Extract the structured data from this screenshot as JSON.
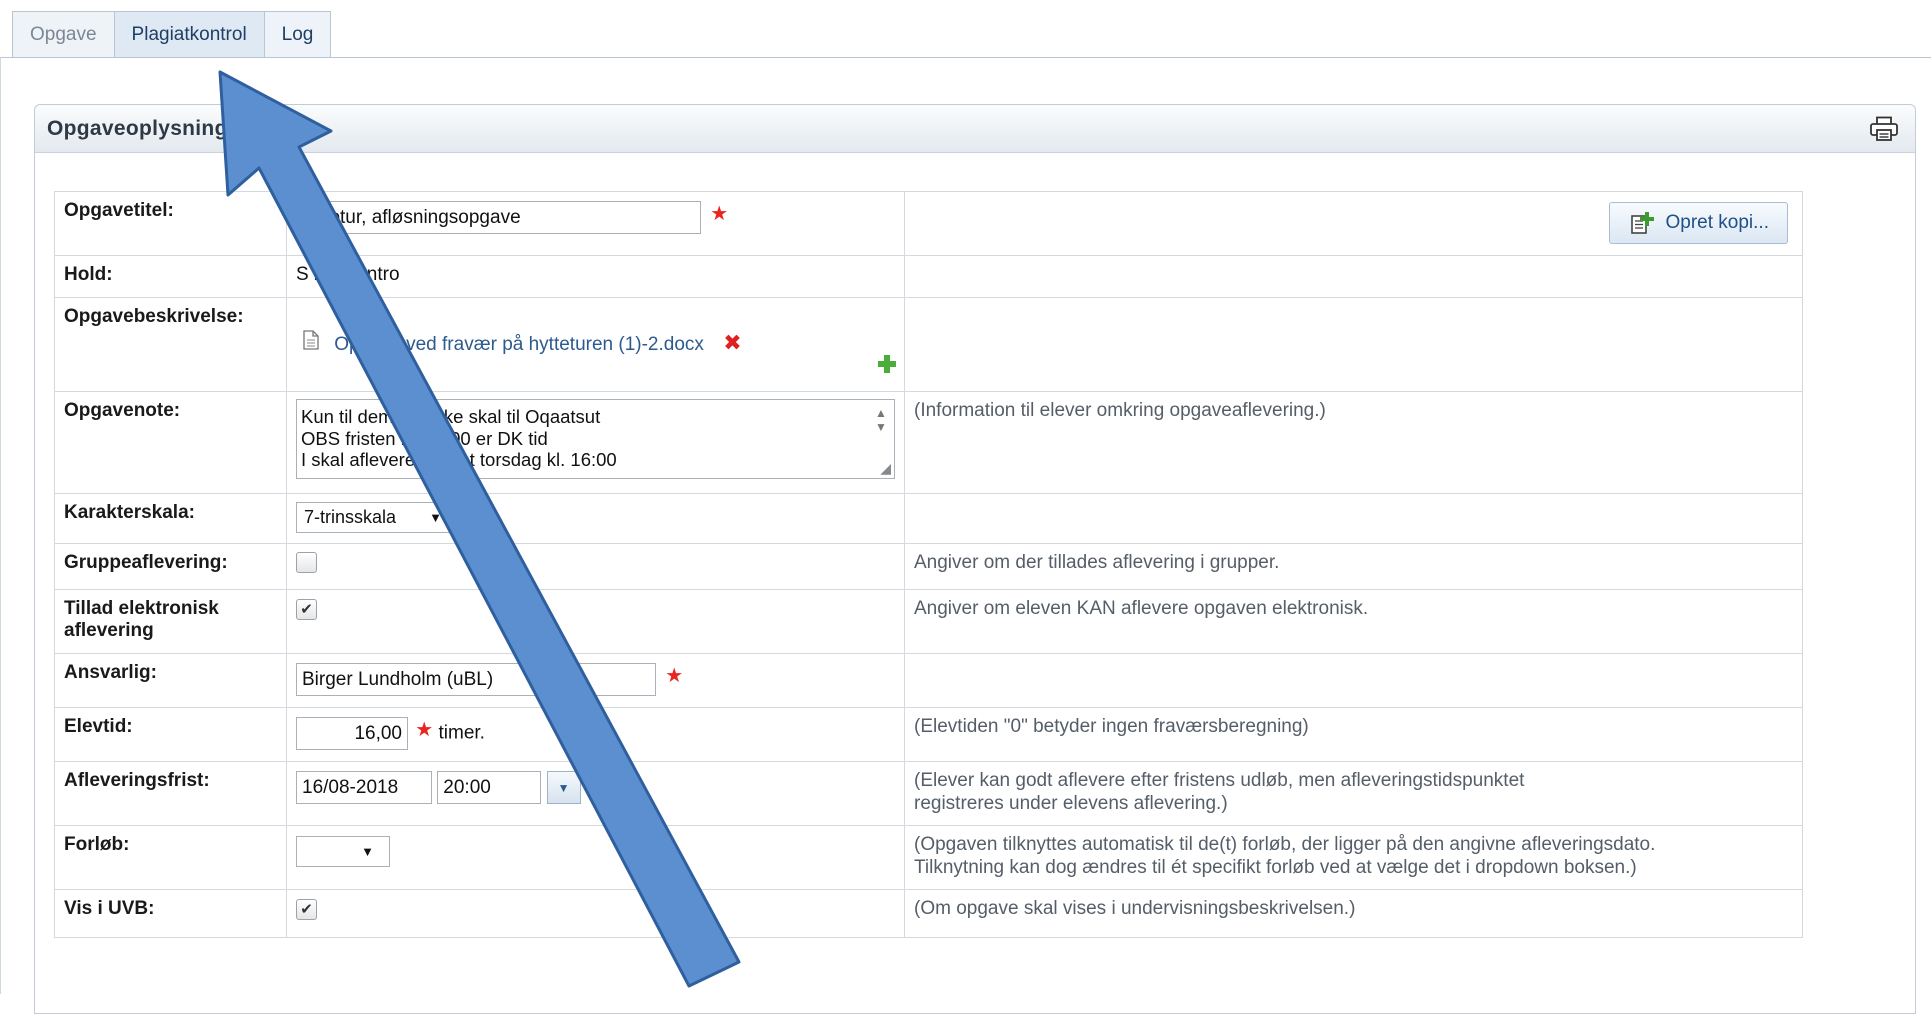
{
  "tabs": [
    {
      "label": "Opgave"
    },
    {
      "label": "Plagiatkontrol"
    },
    {
      "label": "Log"
    }
  ],
  "panel": {
    "title": "Opgaveoplysninger",
    "print_icon": "printer-icon"
  },
  "form": {
    "title": {
      "label": "Opgavetitel:",
      "value": "Introtur, afløsningsopgave",
      "copy_button": "Opret kopi..."
    },
    "team": {
      "label": "Hold:",
      "value": "S 2018 Intro"
    },
    "description": {
      "label": "Opgavebeskrivelse:",
      "file": "Opgave ved fravær på hytteturen (1)-2.docx"
    },
    "note": {
      "label": "Opgavenote:",
      "lines": [
        "Kun til dem der ikke skal til Oqaatsut",
        "OBS fristen kl. 20:00 er DK tid",
        "I skal aflevere senest torsdag kl. 16:00"
      ],
      "hint": "(Information til elever omkring opgaveaflevering.)"
    },
    "grade_scale": {
      "label": "Karakterskala:",
      "value": "7-trinsskala"
    },
    "group": {
      "label": "Gruppeaflevering:",
      "checked": false,
      "hint": "Angiver om der tillades aflevering i grupper."
    },
    "electronic": {
      "label_line1": "Tillad elektronisk",
      "label_line2": "aflevering",
      "checked": true,
      "hint": "Angiver om eleven KAN aflevere opgaven elektronisk."
    },
    "responsible": {
      "label": "Ansvarlig:",
      "value": "Birger Lundholm (uBL)"
    },
    "student_time": {
      "label": "Elevtid:",
      "value": "16,00",
      "unit": "timer.",
      "hint": "(Elevtiden \"0\" betyder ingen fraværsberegning)"
    },
    "deadline": {
      "label": "Afleveringsfrist:",
      "date": "16/08-2018",
      "time": "20:00",
      "hint_line1": "(Elever kan godt aflevere efter fristens udløb, men afleveringstidspunktet",
      "hint_line2": "registreres under elevens aflevering.)"
    },
    "course": {
      "label": "Forløb:",
      "value": "",
      "hint_line1": "(Opgaven tilknyttes automatisk til de(t) forløb, der ligger på den angivne afleveringsdato.",
      "hint_line2": "Tilknytning kan dog ændres til ét specifikt forløb ved at vælge det i dropdown boksen.)"
    },
    "uvb": {
      "label": "Vis i UVB:",
      "checked": true,
      "hint": "(Om opgave skal vises i undervisningsbeskrivelsen.)"
    }
  },
  "colors": {
    "accent": "#2c5a8f",
    "required": "#e8261f",
    "arrow": "#5b8fd0"
  }
}
